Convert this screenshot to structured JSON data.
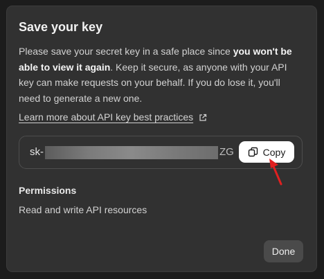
{
  "dialog": {
    "title": "Save your key",
    "description": {
      "part1": "Please save your secret key in a safe place since ",
      "emphasis": "you won't be able to view it again",
      "part2": ". Keep it secure, as anyone with your API key can make requests on your behalf. If you do lose it, you'll need to generate a new one."
    },
    "learn_link": "Learn more about API key best practices",
    "key": {
      "prefix": "sk-",
      "suffix": "ZG"
    },
    "copy_label": "Copy",
    "permissions": {
      "heading": "Permissions",
      "value": "Read and write API resources"
    },
    "done_label": "Done"
  },
  "colors": {
    "backdrop": "#1c1c1c",
    "panel": "#313131",
    "annotation_arrow": "#e02020"
  },
  "icons": [
    "external-link-icon",
    "copy-icon",
    "red-arrow-annotation"
  ]
}
